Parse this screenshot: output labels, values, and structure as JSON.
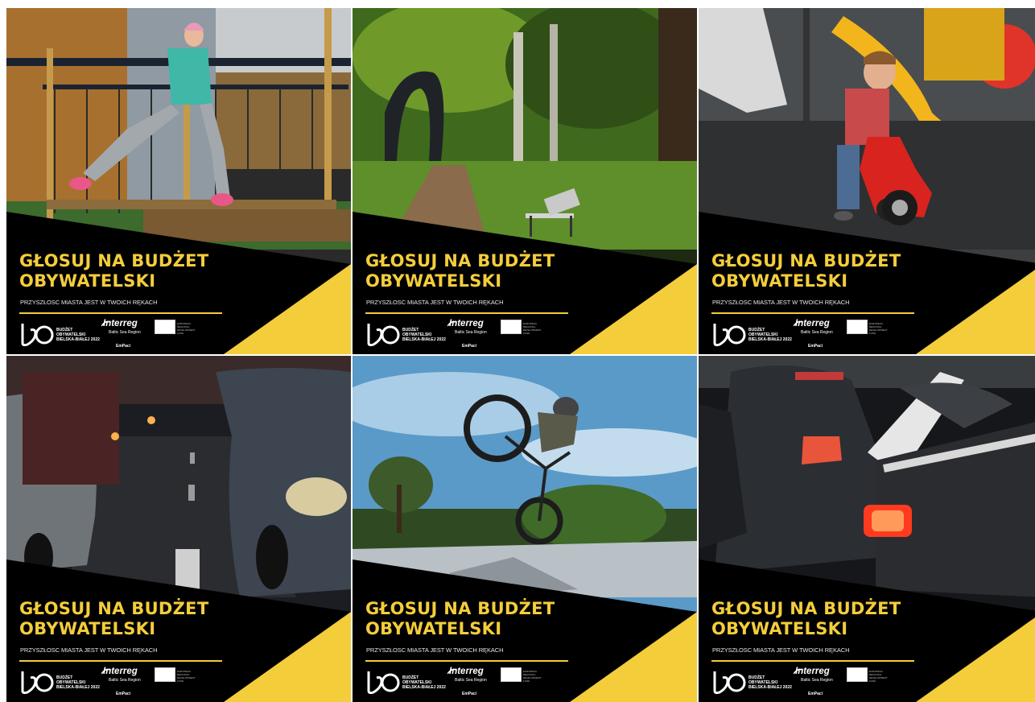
{
  "campaign": {
    "headline": "GŁOSUJ NA BUDŻET\nOBYWATELSKI",
    "subtitle": "PRZYSZŁOSC MIASTA JEST W TWOICH RĘKACH",
    "bo_logo_text": "BUDŻET\nOBYWATELSKI\nBIELSKA-BIAŁEJ 2022",
    "interreg_text": "Interreg",
    "interreg_region": "Baltic Sea Region",
    "eu_text": "EUROPEAN\nREGIONAL\nDEVELOPMENT\nFUND",
    "project_text": "EmPaci",
    "accent_color": "#f4cd3b"
  },
  "tiles": [
    {
      "scene": "playground-rope-bridge"
    },
    {
      "scene": "park-bench"
    },
    {
      "scene": "playground-toy-motorbike"
    },
    {
      "scene": "street-traffic"
    },
    {
      "scene": "skatepark-bmx"
    },
    {
      "scene": "car-taillights"
    }
  ]
}
